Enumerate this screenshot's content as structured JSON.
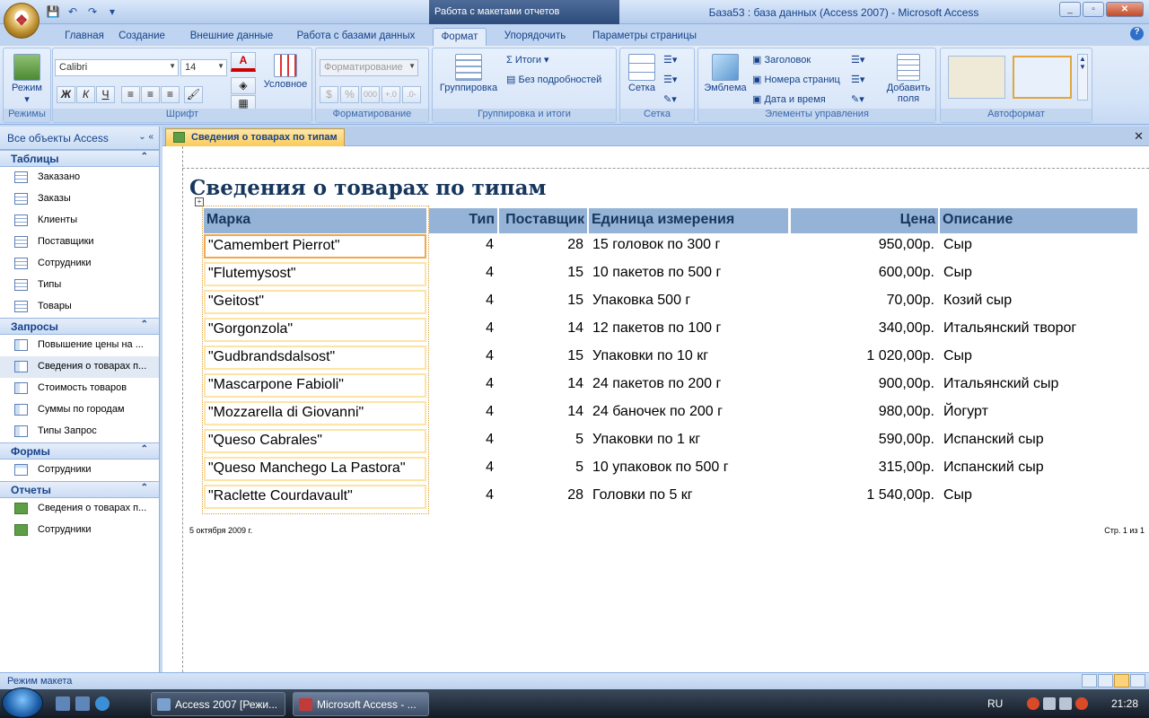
{
  "window": {
    "title": "База53 : база данных (Access 2007) - Microsoft Access",
    "context_tab_title": "Работа с макетами отчетов"
  },
  "ribbon_tabs": [
    "Главная",
    "Создание",
    "Внешние данные",
    "Работа с базами данных",
    "Формат",
    "Упорядочить",
    "Параметры страницы"
  ],
  "ribbon": {
    "views": {
      "label": "Режим",
      "group": "Режимы"
    },
    "font": {
      "family": "Calibri",
      "size": "14",
      "group": "Шрифт",
      "bold": "Ж",
      "italic": "К",
      "underline": "Ч",
      "conditional": "Условное"
    },
    "formatting": {
      "format_value": "Форматирование",
      "group": "Форматирование",
      "percent": "%",
      "thousands": "000"
    },
    "grouping": {
      "group_label": "Группировка",
      "totals": "Итоги",
      "hide_details": "Без подробностей",
      "group": "Группировка и итоги"
    },
    "gridlines": {
      "label": "Сетка",
      "group": "Сетка"
    },
    "controls": {
      "logo": "Эмблема",
      "title": "Заголовок",
      "page_numbers": "Номера страниц",
      "date_time": "Дата и время",
      "add_fields": "Добавить поля",
      "group": "Элементы управления"
    },
    "autoformat": {
      "group": "Автоформат"
    }
  },
  "nav": {
    "header": "Все объекты Access",
    "groups": [
      {
        "name": "Таблицы",
        "type": "tbl",
        "items": [
          "Заказано",
          "Заказы",
          "Клиенты",
          "Поставщики",
          "Сотрудники",
          "Типы",
          "Товары"
        ]
      },
      {
        "name": "Запросы",
        "type": "qry",
        "items": [
          "Повышение цены на ...",
          "Сведения о товарах п...",
          "Стоимость товаров",
          "Суммы по городам",
          "Типы Запрос"
        ]
      },
      {
        "name": "Формы",
        "type": "frm",
        "items": [
          "Сотрудники"
        ]
      },
      {
        "name": "Отчеты",
        "type": "rpt",
        "items": [
          "Сведения о товарах п...",
          "Сотрудники"
        ]
      }
    ]
  },
  "document": {
    "tab_title": "Сведения о товарах по типам",
    "report_title": "Сведения о товарах по типам",
    "columns": [
      "Марка",
      "Тип",
      "Поставщик",
      "Единица измерения",
      "Цена",
      "Описание"
    ],
    "rows": [
      [
        "\"Camembert Pierrot\"",
        "4",
        "28",
        "15 головок по 300 г",
        "950,00р.",
        "Сыр"
      ],
      [
        "\"Flutemysost\"",
        "4",
        "15",
        "10 пакетов по 500 г",
        "600,00р.",
        "Сыр"
      ],
      [
        "\"Geitost\"",
        "4",
        "15",
        "Упаковка 500 г",
        "70,00р.",
        "Козий сыр"
      ],
      [
        "\"Gorgonzola\"",
        "4",
        "14",
        "12 пакетов по 100 г",
        "340,00р.",
        "Итальянский творог"
      ],
      [
        "\"Gudbrandsdalsost\"",
        "4",
        "15",
        "Упаковки по 10 кг",
        "1 020,00р.",
        "Сыр"
      ],
      [
        "\"Mascarpone Fabioli\"",
        "4",
        "14",
        "24 пакетов по 200 г",
        "900,00р.",
        "Итальянский сыр"
      ],
      [
        "\"Mozzarella di Giovanni\"",
        "4",
        "14",
        "24 баночек по 200 г",
        "980,00р.",
        "Йогурт"
      ],
      [
        "\"Queso Cabrales\"",
        "4",
        "5",
        "Упаковки по 1 кг",
        "590,00р.",
        "Испанский сыр"
      ],
      [
        "\"Queso Manchego La Pastora\"",
        "4",
        "5",
        "10 упаковок по 500 г",
        "315,00р.",
        "Испанский сыр"
      ],
      [
        "\"Raclette Courdavault\"",
        "4",
        "28",
        "Головки по 5 кг",
        "1 540,00р.",
        "Сыр"
      ]
    ],
    "footer_date": "5 октября 2009 г.",
    "footer_page": "Стр. 1 из 1"
  },
  "status": {
    "mode": "Режим макета"
  },
  "taskbar": {
    "tasks": [
      "Access 2007 [Режи...",
      "Microsoft Access - ..."
    ],
    "lang": "RU",
    "time": "21:28"
  }
}
